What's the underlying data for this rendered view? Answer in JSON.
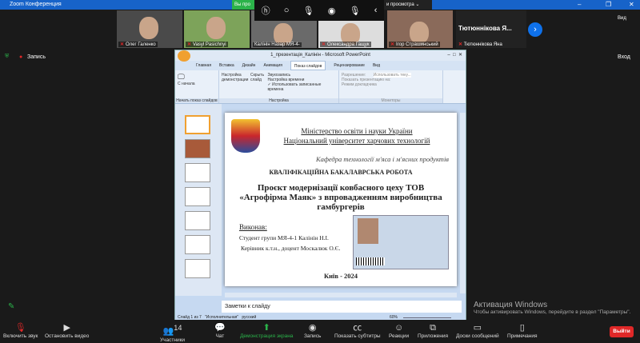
{
  "window": {
    "title": "Zoom Конференция",
    "minimize": "–",
    "maximize": "❐",
    "close": "✕"
  },
  "banner": {
    "sharing": "Вы про",
    "view_options": "и просмотра ⌄"
  },
  "participants": [
    {
      "name": "Олег Галенко"
    },
    {
      "name": "Vasyl Pasichnyi"
    },
    {
      "name": "Калінін Назар МЯ-4-"
    },
    {
      "name": "Олександра Гащук"
    },
    {
      "name": "Ігор Страшинський"
    }
  ],
  "name_tile": {
    "big": "Тютюннікова Я...",
    "small": "Тютюннікова Яна"
  },
  "rec": {
    "label": "Запись",
    "view": "Вид",
    "enter": "Вход"
  },
  "ppt": {
    "title": "1_презентація_Калінін - Microsoft PowerPoint",
    "tabs": [
      "Главная",
      "Вставка",
      "Дизайн",
      "Анимация",
      "Показ слайдов",
      "Рецензирование",
      "Вид"
    ],
    "active_tab": "Показ слайдов",
    "groups": {
      "start": {
        "from_start": "С начала",
        "label": "Начать показ слайдов"
      },
      "setup": {
        "setup_show": "Настройка демонстрации",
        "hide_slide": "Скрыть слайд",
        "record": "Звукозапись",
        "timing": "Настройка времени",
        "use_timings": "Использовать записанные времена",
        "label": "Настройка"
      },
      "monitors": {
        "resolution": "Разрешение:",
        "resolution_value": "Использовать теку...",
        "show_on": "Показать презентацию на:",
        "presenter": "Режим докладчика",
        "label": "Мониторы"
      }
    },
    "slide": {
      "ministry": "Міністерство освіти і науки України",
      "university": "Національний університет харчових технологій",
      "department": "Кафедра технології м'яса і м'ясних продуктів",
      "work_type": "КВАЛІФІКАЦІЙНА БАКАЛАВРСЬКА РОБОТА",
      "title": "Проєкт модернізації ковбасного цеху ТОВ «Агрофірма Маяк» з впровадженням виробництва гамбургерів",
      "done_by": "Виконав:",
      "student": "Студент групи МЯ-4-1 Калінін Н.І.",
      "supervisor": "Керівник к.т.н., доцент Москалюк О.Є.",
      "city_year": "Київ - 2024"
    },
    "notes_placeholder": "Заметки к слайду",
    "status": {
      "slide": "Слайд 1 из 7",
      "theme": "\"Исполнительная\"",
      "lang": "русский",
      "zoom": "60%"
    }
  },
  "activation": {
    "title": "Активация Windows",
    "text": "Чтобы активировать Windows, перейдите в раздел \"Параметры\"."
  },
  "toolbar": {
    "unmute": "Включить звук",
    "stop_video": "Остановить видео",
    "participants": "Участники",
    "participants_count": "14",
    "chat": "Чат",
    "share": "Демонстрация экрана",
    "record": "Запись",
    "captions": "Показать субтитры",
    "reactions": "Реакции",
    "apps": "Приложения",
    "whiteboards": "Доски сообщений",
    "notes": "Примечания",
    "leave": "Выйти"
  },
  "colors": {
    "zoom_blue": "#1763c9",
    "share_green": "#2bb34a",
    "leave_red": "#e02828"
  }
}
